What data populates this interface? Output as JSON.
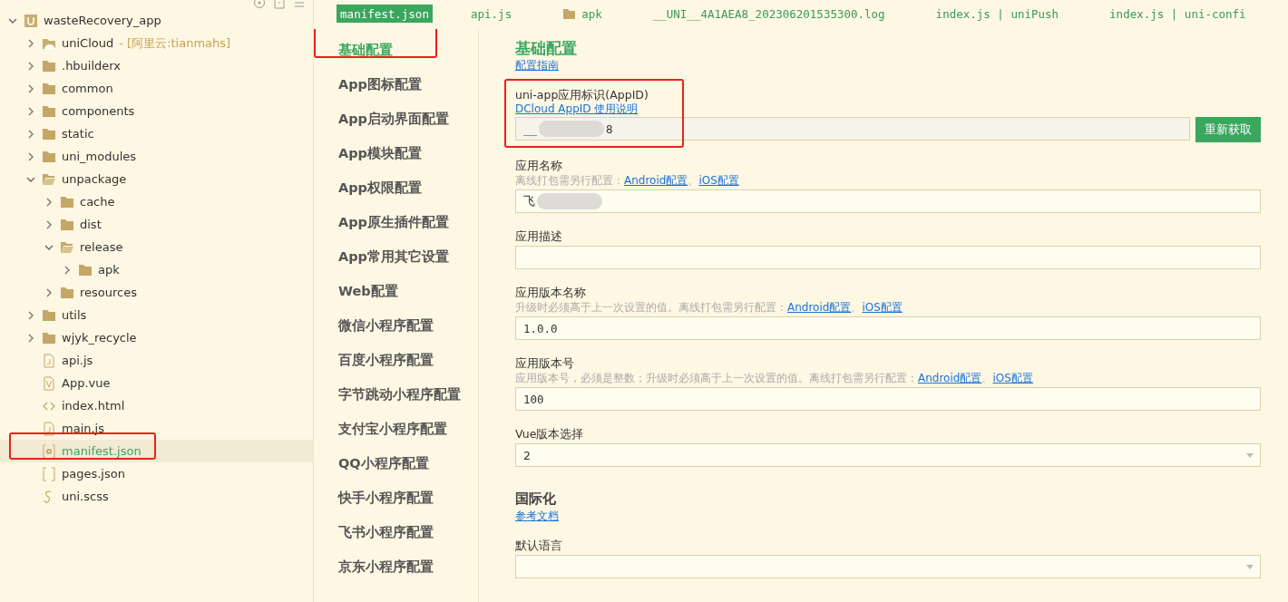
{
  "explorer": {
    "tree": [
      {
        "label": "wasteRecovery_app",
        "kind": "project",
        "expanded": true,
        "selected": false,
        "children": [
          {
            "label": "uniCloud",
            "suffix": "- [阿里云:tianmahs]",
            "kind": "cloud",
            "expanded": false,
            "selected": false
          },
          {
            "label": ".hbuilderx",
            "kind": "folder",
            "expanded": false,
            "selected": false
          },
          {
            "label": "common",
            "kind": "folder",
            "expanded": false,
            "selected": false
          },
          {
            "label": "components",
            "kind": "folder",
            "expanded": false,
            "selected": false
          },
          {
            "label": "static",
            "kind": "folder",
            "expanded": false,
            "selected": false
          },
          {
            "label": "uni_modules",
            "kind": "folder",
            "expanded": false,
            "selected": false
          },
          {
            "label": "unpackage",
            "kind": "folder",
            "expanded": true,
            "selected": false,
            "children": [
              {
                "label": "cache",
                "kind": "folder",
                "expanded": false,
                "selected": false
              },
              {
                "label": "dist",
                "kind": "folder",
                "expanded": false,
                "selected": false
              },
              {
                "label": "release",
                "kind": "folder",
                "expanded": true,
                "selected": false,
                "children": [
                  {
                    "label": "apk",
                    "kind": "folder",
                    "expanded": false,
                    "selected": false
                  }
                ]
              },
              {
                "label": "resources",
                "kind": "folder",
                "expanded": false,
                "selected": false
              }
            ]
          },
          {
            "label": "utils",
            "kind": "folder",
            "expanded": false,
            "selected": false
          },
          {
            "label": "wjyk_recycle",
            "kind": "folder",
            "expanded": false,
            "selected": false
          },
          {
            "label": "api.js",
            "kind": "js",
            "selected": false
          },
          {
            "label": "App.vue",
            "kind": "vue",
            "selected": false
          },
          {
            "label": "index.html",
            "kind": "html",
            "selected": false
          },
          {
            "label": "main.js",
            "kind": "js",
            "selected": false
          },
          {
            "label": "manifest.json",
            "kind": "manifest",
            "selected": true,
            "highlighted": true
          },
          {
            "label": "pages.json",
            "kind": "json",
            "selected": false
          },
          {
            "label": "uni.scss",
            "kind": "scss",
            "selected": false
          }
        ]
      }
    ]
  },
  "tabs": [
    {
      "label": "manifest.json",
      "kind": "file",
      "selected": true
    },
    {
      "label": "api.js",
      "kind": "file",
      "selected": false
    },
    {
      "label": "apk",
      "kind": "folder",
      "selected": false
    },
    {
      "label": "__UNI__4A1AEA8_202306201535300.log",
      "kind": "file",
      "selected": false
    },
    {
      "label": "index.js | uniPush",
      "kind": "file",
      "selected": false
    },
    {
      "label": "index.js | uni-confi",
      "kind": "file",
      "selected": false
    }
  ],
  "nav": [
    {
      "label": "基础配置",
      "selected": true,
      "highlighted": true
    },
    {
      "label": "App图标配置",
      "selected": false
    },
    {
      "label": "App启动界面配置",
      "selected": false
    },
    {
      "label": "App模块配置",
      "selected": false
    },
    {
      "label": "App权限配置",
      "selected": false
    },
    {
      "label": "App原生插件配置",
      "selected": false
    },
    {
      "label": "App常用其它设置",
      "selected": false
    },
    {
      "label": "Web配置",
      "selected": false
    },
    {
      "label": "微信小程序配置",
      "selected": false
    },
    {
      "label": "百度小程序配置",
      "selected": false
    },
    {
      "label": "字节跳动小程序配置",
      "selected": false
    },
    {
      "label": "支付宝小程序配置",
      "selected": false
    },
    {
      "label": "QQ小程序配置",
      "selected": false
    },
    {
      "label": "快手小程序配置",
      "selected": false
    },
    {
      "label": "飞书小程序配置",
      "selected": false
    },
    {
      "label": "京东小程序配置",
      "selected": false
    }
  ],
  "sections": [
    {
      "title": "基础配置",
      "link": "配置指南",
      "fields": [
        {
          "kind": "appid",
          "label": "uni-app应用标识(AppID)",
          "link": "DCloud AppID 使用说明",
          "value": "__",
          "value_end": "8",
          "blurred": true,
          "button": "重新获取",
          "highlighted": true
        },
        {
          "kind": "text",
          "label": "应用名称",
          "hint": [
            {
              "kind": "text",
              "text": "离线打包需另行配置："
            },
            {
              "kind": "link",
              "text": "Android配置"
            },
            {
              "kind": "text",
              "text": "、"
            },
            {
              "kind": "link",
              "text": "iOS配置"
            }
          ],
          "value": "飞",
          "blurred": true
        },
        {
          "kind": "text",
          "label": "应用描述"
        },
        {
          "kind": "text",
          "label": "应用版本名称",
          "hint": [
            {
              "kind": "text",
              "text": "升级时必须高于上一次设置的值。离线打包需另行配置："
            },
            {
              "kind": "link",
              "text": "Android配置"
            },
            {
              "kind": "text",
              "text": "、"
            },
            {
              "kind": "link",
              "text": "iOS配置"
            }
          ],
          "value": "1.0.0"
        },
        {
          "kind": "text",
          "label": "应用版本号",
          "hint": [
            {
              "kind": "text",
              "text": "应用版本号，必须是整数；升级时必须高于上一次设置的值。离线打包需另行配置："
            },
            {
              "kind": "link",
              "text": "Android配置"
            },
            {
              "kind": "text",
              "text": "、"
            },
            {
              "kind": "link",
              "text": "iOS配置"
            }
          ],
          "value": "100"
        },
        {
          "kind": "select",
          "label": "Vue版本选择",
          "value": "2"
        }
      ]
    },
    {
      "title": "国际化",
      "link": "参考文档",
      "fields": [
        {
          "kind": "select",
          "label": "默认语言"
        }
      ]
    }
  ]
}
